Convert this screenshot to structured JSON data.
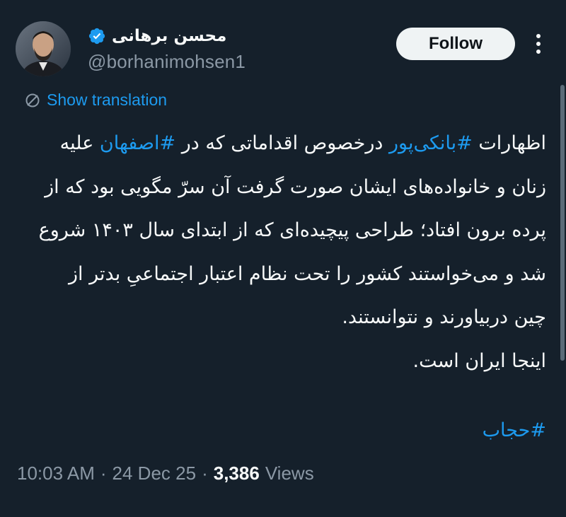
{
  "author": {
    "display_name": "محسن برهانی",
    "handle": "@borhanimohsen1",
    "verified": true,
    "avatar_icon": "profile-photo"
  },
  "follow_button": {
    "label": "Follow"
  },
  "more_icon": "ellipsis-vertical-icon",
  "translation": {
    "icon": "globe-icon",
    "label": "Show translation"
  },
  "tweet": {
    "lines": [
      {
        "before": "اظهارات ",
        "tag1": "#بانکی‌پور",
        "middle": " درخصوص اقداماتی که در ",
        "tag2": "#اصفهان",
        "after": " علیه"
      },
      {
        "text": "زنان و خانواده‌های ایشان صورت گرفت آن سرّ مگویی بود که از"
      },
      {
        "text": "پرده برون افتاد؛ طراحی پیچیده‌ای که از ابتدای سال ۱۴۰۳ شروع"
      },
      {
        "text": "شد و می‌خواستند کشور را تحت نظام اعتبار اجتماعیِ بدتر از"
      },
      {
        "text": "چین دربیاورند و نتوانستند."
      },
      {
        "text": "اینجا ایران است."
      }
    ],
    "hashtag": "#حجاب"
  },
  "meta": {
    "time": "10:03 AM",
    "date": "24 Dec 25",
    "views_count": "3,386",
    "views_label": "Views"
  },
  "colors": {
    "background": "#15202b",
    "text": "#f7f9f9",
    "secondary": "#8b98a5",
    "link": "#1d9bf0",
    "button_bg": "#eff3f4"
  }
}
